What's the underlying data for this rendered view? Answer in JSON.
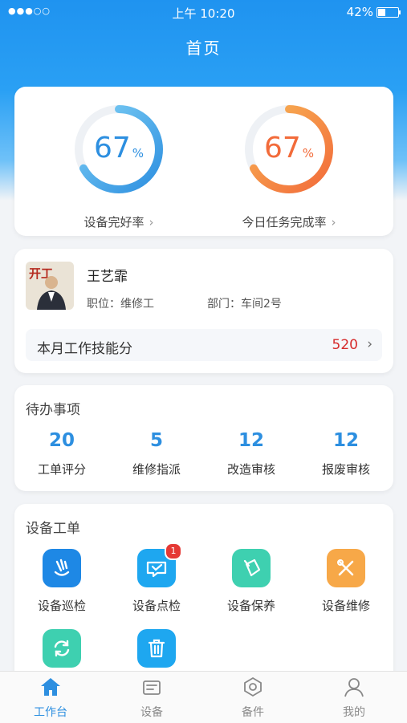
{
  "status_bar": {
    "signal": "●●●○○",
    "time": "上午 10:20",
    "battery": "42%",
    "battery_level": 0.42
  },
  "header": {
    "title": "首页"
  },
  "stats": [
    {
      "value": "67",
      "unit": "%",
      "label": "设备完好率",
      "fraction": 0.67,
      "color_start": "#2d8fe0",
      "color_end": "#7fd0f5"
    },
    {
      "value": "67",
      "unit": "%",
      "label": "今日任务完成率",
      "fraction": 0.67,
      "color_start": "#f26b3a",
      "color_end": "#f8b555"
    }
  ],
  "profile": {
    "name": "王艺霏",
    "position_label": "职位：",
    "position": "维修工",
    "dept_label": "部门：",
    "dept": "车间2号",
    "skill_label": "本月工作技能分",
    "skill_score": "520"
  },
  "todos": {
    "title": "待办事项",
    "items": [
      {
        "count": "20",
        "label": "工单评分"
      },
      {
        "count": "5",
        "label": "维修指派"
      },
      {
        "count": "12",
        "label": "改造审核"
      },
      {
        "count": "12",
        "label": "报废审核"
      }
    ]
  },
  "orders": {
    "title": "设备工单",
    "items": [
      {
        "label": "设备巡检",
        "icon": "inspection-icon",
        "color": "#1e88e5"
      },
      {
        "label": "设备点检",
        "icon": "spot-check-icon",
        "color": "#1ea7f0",
        "badge": "1"
      },
      {
        "label": "设备保养",
        "icon": "maintenance-icon",
        "color": "#3ed0b0"
      },
      {
        "label": "设备维修",
        "icon": "repair-icon",
        "color": "#f7a848"
      },
      {
        "label": "",
        "icon": "refresh-icon",
        "color": "#3ed0b0"
      },
      {
        "label": "",
        "icon": "trash-icon",
        "color": "#1ea7f0"
      }
    ]
  },
  "tabbar": [
    {
      "label": "工作台",
      "icon": "home-icon",
      "active": true
    },
    {
      "label": "设备",
      "icon": "device-icon",
      "active": false
    },
    {
      "label": "备件",
      "icon": "parts-icon",
      "active": false
    },
    {
      "label": "我的",
      "icon": "user-icon",
      "active": false
    }
  ],
  "avatar": {
    "sign_text": "开工"
  }
}
